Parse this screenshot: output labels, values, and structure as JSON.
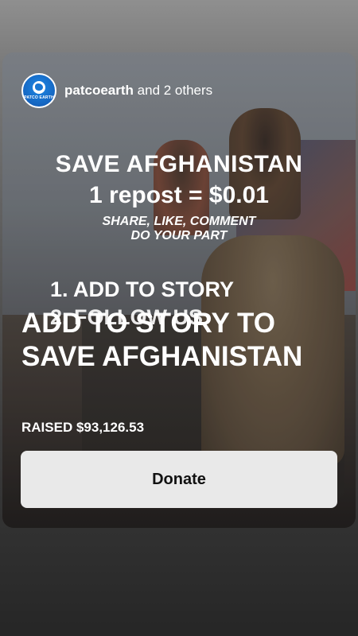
{
  "header": {
    "account": "patcoearth",
    "others": "and 2 others",
    "avatar_brand": "PATCO EARTH"
  },
  "image_text": {
    "headline": "SAVE AFGHANISTAN",
    "repost": "1 repost = $0.01",
    "cta_line1": "SHARE, LIKE, COMMENT",
    "cta_line2": "DO YOUR PART",
    "step1": "1. ADD TO STORY",
    "step2": "2. FOLLOW US"
  },
  "sticker": {
    "title": "ADD TO STORY TO SAVE AFGHANISTAN",
    "raised": "RAISED $93,126.53",
    "donate_label": "Donate"
  },
  "colors": {
    "avatar_blue": "#1565c0",
    "button_bg": "#e9e9e9",
    "text": "#ffffff"
  }
}
